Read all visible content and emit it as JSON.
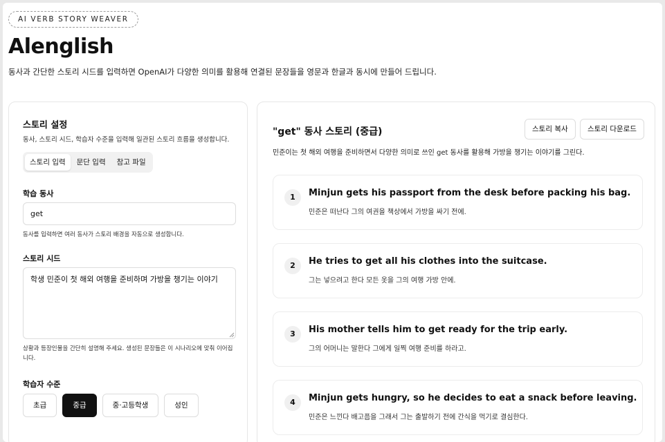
{
  "header": {
    "badge": "AI VERB STORY WEAVER",
    "title": "Alenglish",
    "subtitle": "동사과 간단한 스토리 시드를 입력하면 OpenAI가 다양한 의미를 활용해 연결된 문장들을 영문과 한글과 동시에 만들어 드립니다."
  },
  "settings": {
    "title": "스토리 설정",
    "description": "동사, 스토리 시드, 학습자 수준을 입력해 일관된 스토리 흐름을 생성합니다.",
    "tabs": [
      {
        "label": "스토리 입력",
        "active": true
      },
      {
        "label": "문단 입력",
        "active": false
      },
      {
        "label": "참고 파일",
        "active": false
      }
    ],
    "verb_label": "학습 동사",
    "verb_value": "get",
    "verb_hint": "동사를 입력하면 여러 동사가 스토리 배경을 자동으로 생성합니다.",
    "seed_label": "스토리 시드",
    "seed_value": "학생 민준이 첫 해외 여행을 준비하며 가방을 챙기는 이야기",
    "seed_hint": "상황과 등장인물을 간단히 설명해 주세요. 생성된 문장들은 이 시나리오에 맞춰 이어집니다.",
    "level_label": "학습자 수준",
    "levels": [
      {
        "label": "초급",
        "selected": false
      },
      {
        "label": "중급",
        "selected": true
      },
      {
        "label": "중·고등학생",
        "selected": false
      },
      {
        "label": "성인",
        "selected": false
      }
    ]
  },
  "story": {
    "title": "\"get\" 동사 스토리 (중급)",
    "copy_label": "스토리 복사",
    "download_label": "스토리 다운로드",
    "description": "민준이는 첫 해외 여행을 준비하면서 다양한 의미로 쓰인 get 동사를 활용해 가방을 챙기는 이야기를 그린다.",
    "sentences": [
      {
        "num": "1",
        "en": "Minjun gets his passport from the desk before packing his bag.",
        "ko": "민준은 떠난다 그의 여권을 책상에서 가방을 싸기 전에."
      },
      {
        "num": "2",
        "en": "He tries to get all his clothes into the suitcase.",
        "ko": "그는 넣으려고 한다 모든 옷을 그의 여행 가방 안에."
      },
      {
        "num": "3",
        "en": "His mother tells him to get ready for the trip early.",
        "ko": "그의 어머니는 말한다 그에게 일찍 여행 준비를 하라고."
      },
      {
        "num": "4",
        "en": "Minjun gets hungry, so he decides to eat a snack before leaving.",
        "ko": "민준은 느낀다 배고픔을 그래서 그는 출발하기 전에 간식을 먹기로 결심한다."
      }
    ]
  }
}
